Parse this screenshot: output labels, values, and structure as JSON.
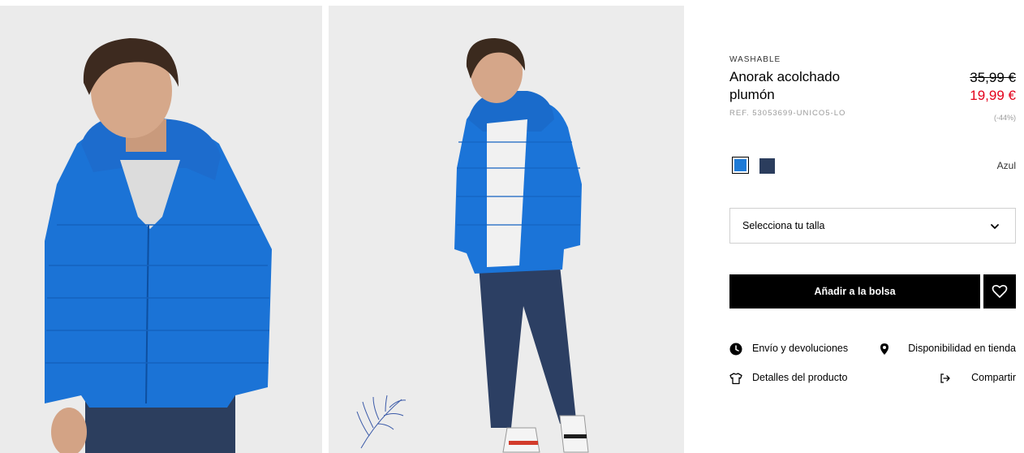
{
  "gallery": {
    "photo1_alt": "",
    "photo2_alt": ""
  },
  "product": {
    "tag": "WASHABLE",
    "title": "Anorak acolchado plumón",
    "ref": "REF. 53053699-UNICO5-LO",
    "price_old": "35,99 €",
    "price_new": "19,99 €",
    "discount": "(-44%)",
    "selected_color": "Azul",
    "colors": [
      {
        "name": "blue",
        "hex": "#1e7bd7",
        "selected": true
      },
      {
        "name": "navy",
        "hex": "#2b3d5d",
        "selected": false
      }
    ],
    "accent_price_color": "#e3001b"
  },
  "size_select": {
    "placeholder": "Selecciona tu talla",
    "icon": "chevron-down-icon"
  },
  "actions": {
    "add_to_bag": "Añadir a la bolsa",
    "favorite_icon": "heart-icon"
  },
  "links": {
    "shipping": "Envío y devoluciones",
    "store": "Disponibilidad en tienda",
    "details": "Detalles del producto",
    "share": "Compartir"
  }
}
